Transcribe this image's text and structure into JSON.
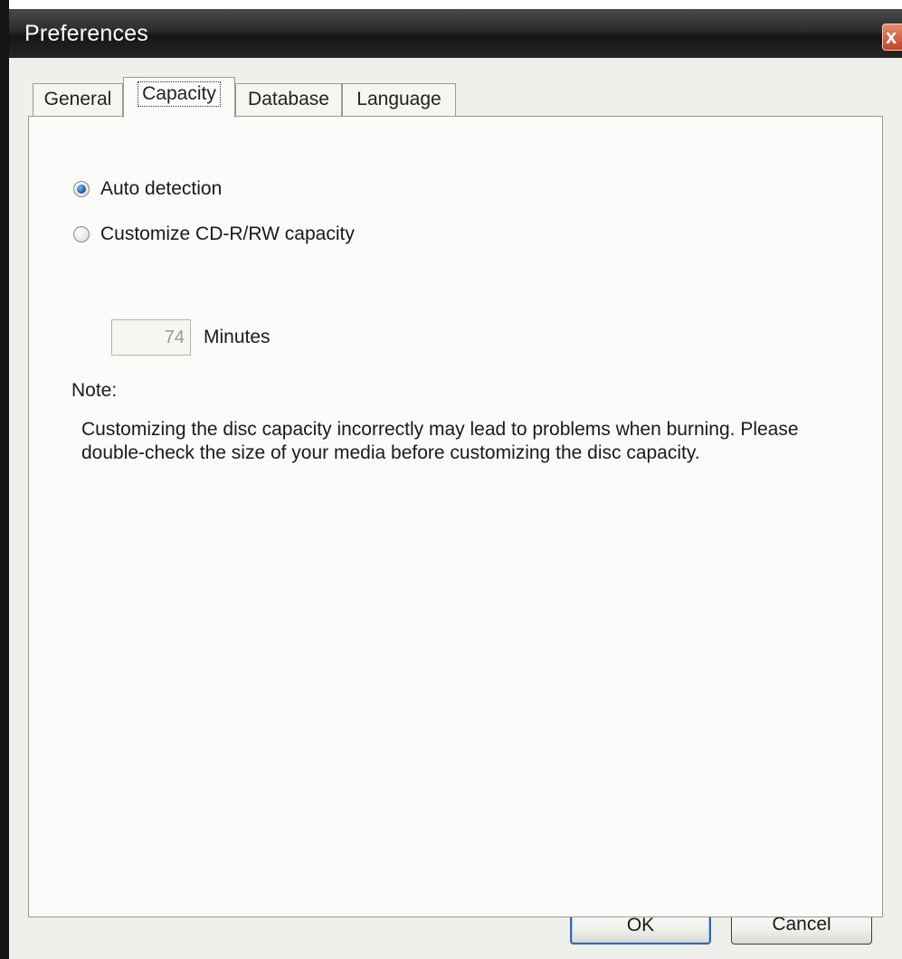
{
  "window": {
    "title": "Preferences",
    "close_label": "x"
  },
  "tabs": [
    {
      "label": "General",
      "selected": false
    },
    {
      "label": "Capacity",
      "selected": true
    },
    {
      "label": "Database",
      "selected": false
    },
    {
      "label": "Language",
      "selected": false
    }
  ],
  "capacity": {
    "options": [
      {
        "label": "Auto detection",
        "checked": true
      },
      {
        "label": "Customize CD-R/RW capacity",
        "checked": false
      }
    ],
    "minutes_value": "74",
    "minutes_label": "Minutes",
    "note_label": "Note:",
    "note_text": "Customizing the disc capacity incorrectly may lead to problems when burning. Please double-check the size of your media before customizing the disc capacity."
  },
  "buttons": {
    "ok_label": "OK",
    "cancel_label": "Cancel"
  },
  "colors": {
    "title_bar": "#262626",
    "dialog_bg": "#efefec",
    "panel_bg": "#fbfbf9",
    "close_button": "#c2442a",
    "default_button_border": "#3a66b0"
  },
  "icons": [
    "close-icon",
    "radio-checked-icon",
    "radio-unchecked-icon"
  ]
}
